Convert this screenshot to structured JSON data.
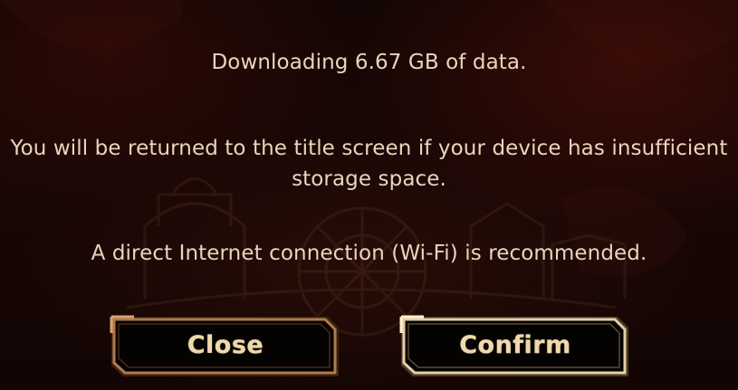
{
  "dialog": {
    "download_message": "Downloading 6.67 GB of data.",
    "storage_warning": "You will be returned to the title screen if your device has insufficient storage space.",
    "connection_note": "A direct Internet connection (Wi-Fi) is recommended."
  },
  "buttons": {
    "close_label": "Close",
    "confirm_label": "Confirm"
  },
  "colors": {
    "message_text": "#e9d6bc",
    "button_label": "#f0d8ad",
    "close_frame": "#b07a4e",
    "confirm_frame": "#e6cfa8",
    "button_fill": "#050302"
  }
}
